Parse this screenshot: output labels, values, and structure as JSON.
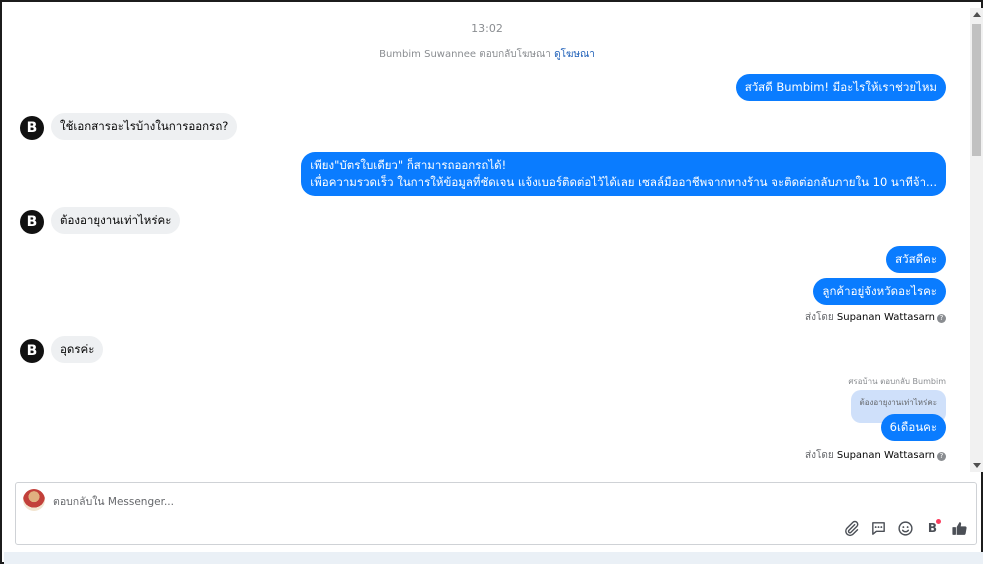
{
  "chat": {
    "timestamp": "13:02",
    "reply_notice": {
      "text": "Bumbim Suwannee ตอบกลับโฆษณา",
      "link": "ดูโฆษณา"
    },
    "messages": [
      {
        "id": "m1",
        "dir": "out",
        "text": "สวัสดี Bumbim! มีอะไรให้เราช่วยไหม"
      },
      {
        "id": "m2",
        "dir": "in",
        "text": "ใช้เอกสารอะไรบ้างในการออกรถ?"
      },
      {
        "id": "m3",
        "dir": "out",
        "line1": "เพียง\"บัตรใบเดียว\" ก็สามารถออกรถได้!",
        "line2": "เพื่อความรวดเร็ว ในการให้ข้อมูลที่ชัดเจน แจ้งเบอร์ติดต่อไว้ได้เลย เซลล์มืออาชีพจากทางร้าน จะติดต่อกลับภายใน 10 นาทีจ้า..."
      },
      {
        "id": "m4",
        "dir": "in",
        "text": "ต้องอายุงานเท่าไหร่คะ"
      },
      {
        "id": "m5",
        "dir": "out",
        "text": "สวัสดีคะ"
      },
      {
        "id": "m6",
        "dir": "out",
        "text": "ลูกค้าอยู่จังหวัดอะไรคะ"
      },
      {
        "id": "m7",
        "dir": "in",
        "text": "อุดรค่ะ"
      },
      {
        "id": "m8",
        "dir": "out",
        "text": "6เดือนคะ"
      }
    ],
    "sent_by_1": {
      "prefix": "ส่งโดย",
      "name": "Supanan Wattasarn"
    },
    "sent_by_2": {
      "prefix": "ส่งโดย",
      "name": "Supanan Wattasarn"
    },
    "quote": {
      "meta": "ศรอบ้าน ตอบกลับ Bumbim",
      "text": "ต้องอายุงานเท่าไหร่คะ"
    },
    "avatar_letter": "B"
  },
  "composer": {
    "placeholder": "ตอบกลับใน Messenger...",
    "tools": [
      "paperclip-icon",
      "saved-reply-icon",
      "emoji-icon",
      "b-badge-icon",
      "thumbs-up-icon"
    ],
    "b_icon_label": "B",
    "accent": "#0a7cff"
  }
}
